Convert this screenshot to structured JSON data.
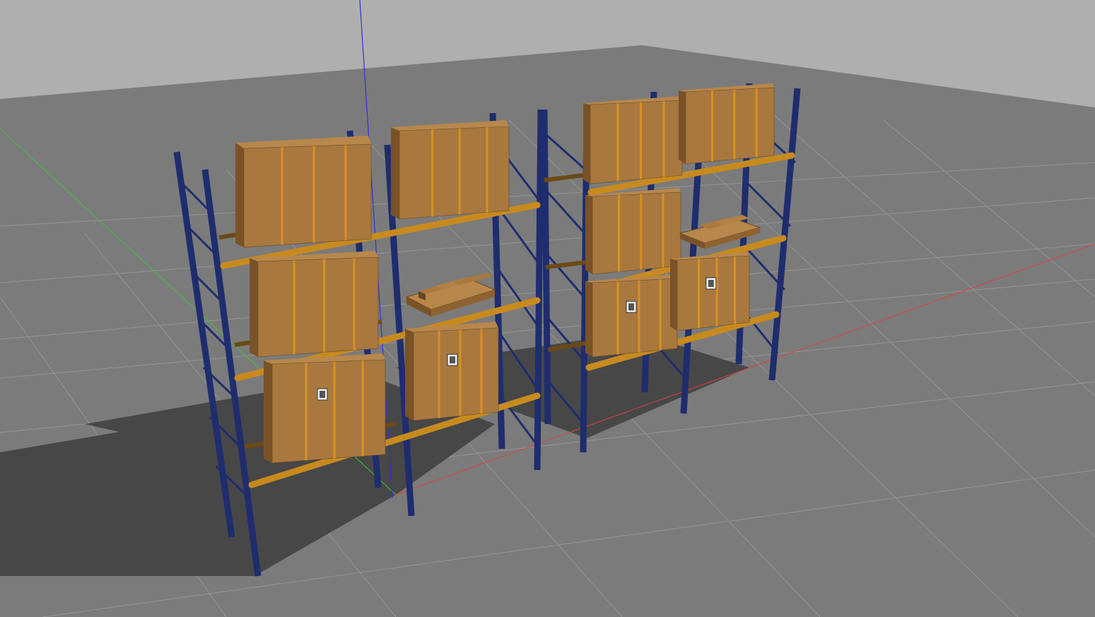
{
  "viewport": {
    "name": "3d-simulation-viewport",
    "background_color": "#afafaf",
    "ground_color": "#7b7b7b",
    "grid_line_color": "#9a9a9a",
    "shadow_color": "#3c3c3c"
  },
  "axes": [
    {
      "name": "x-axis",
      "color": "#e04040"
    },
    {
      "name": "y-axis",
      "color": "#40c040"
    },
    {
      "name": "z-axis",
      "color": "#3030e0"
    }
  ],
  "racks": {
    "count": 2,
    "upright_color": "#1f2d6e",
    "beam_color": "#c88a1e",
    "bays_per_rack": 2,
    "levels_per_bay": 3
  },
  "boxes": {
    "face_color": "#a8783f",
    "side_color": "#7a5228",
    "top_color": "#b8874c",
    "tape_color": "#d89020",
    "marker_icon": "qr-marker-icon",
    "count": 10
  },
  "pallets": {
    "count": 2,
    "color": "#b8874c"
  }
}
